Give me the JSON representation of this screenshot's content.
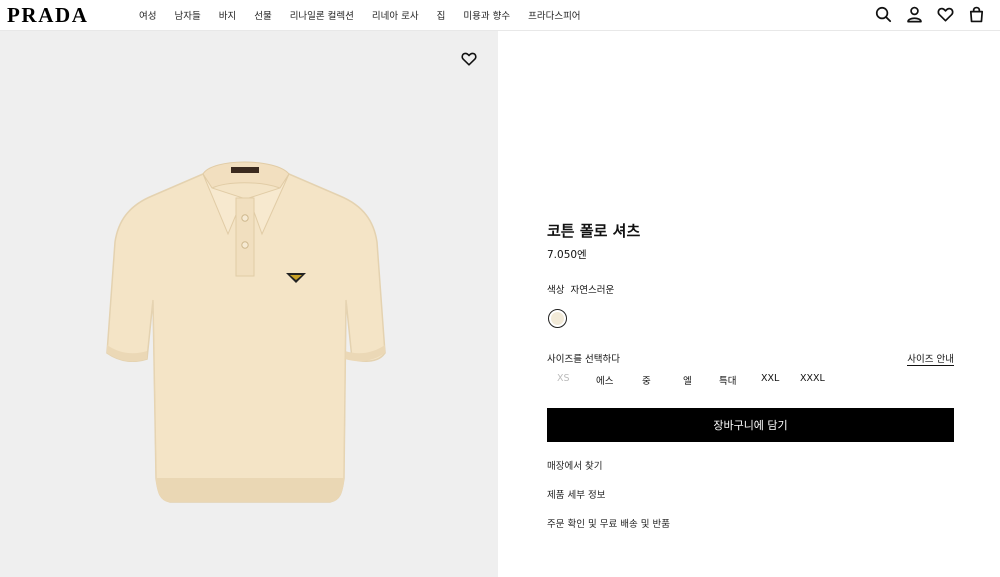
{
  "brand": {
    "logo": "PRADA"
  },
  "nav": {
    "items": [
      {
        "label": "여성"
      },
      {
        "label": "남자들"
      },
      {
        "label": "바지"
      },
      {
        "label": "선물"
      },
      {
        "label": "리나일론 컬렉션"
      },
      {
        "label": "리네아 로사"
      },
      {
        "label": "집"
      },
      {
        "label": "미용과 향수"
      },
      {
        "label": "프라다스피어"
      }
    ]
  },
  "header_icons": [
    "search-icon",
    "account-icon",
    "wishlist-icon",
    "shopping-bag-icon"
  ],
  "product": {
    "title": "코튼 폴로 셔츠",
    "price": "7.050엔",
    "color_label": "색상",
    "color_value": "자연스러운",
    "swatch_color": "#f2ead8",
    "size_label": "사이즈를 선택하다",
    "size_guide": "사이즈 안내",
    "sizes": [
      {
        "label": "XS",
        "available": false
      },
      {
        "label": "에스",
        "available": true
      },
      {
        "label": "중",
        "available": true
      },
      {
        "label": "엘",
        "available": true
      },
      {
        "label": "특대",
        "available": true
      },
      {
        "label": "XXL",
        "available": true
      },
      {
        "label": "XXXL",
        "available": true
      }
    ],
    "add_to_cart": "장바구니에 담기",
    "links": [
      {
        "label": "매장에서 찾기"
      },
      {
        "label": "제품 세부 정보"
      },
      {
        "label": "주문 확인 및 무료 배송 및 반품"
      }
    ]
  },
  "colors": {
    "accent": "#000000",
    "gallery_bg": "#efefef",
    "shirt": "#f4e4c6"
  }
}
